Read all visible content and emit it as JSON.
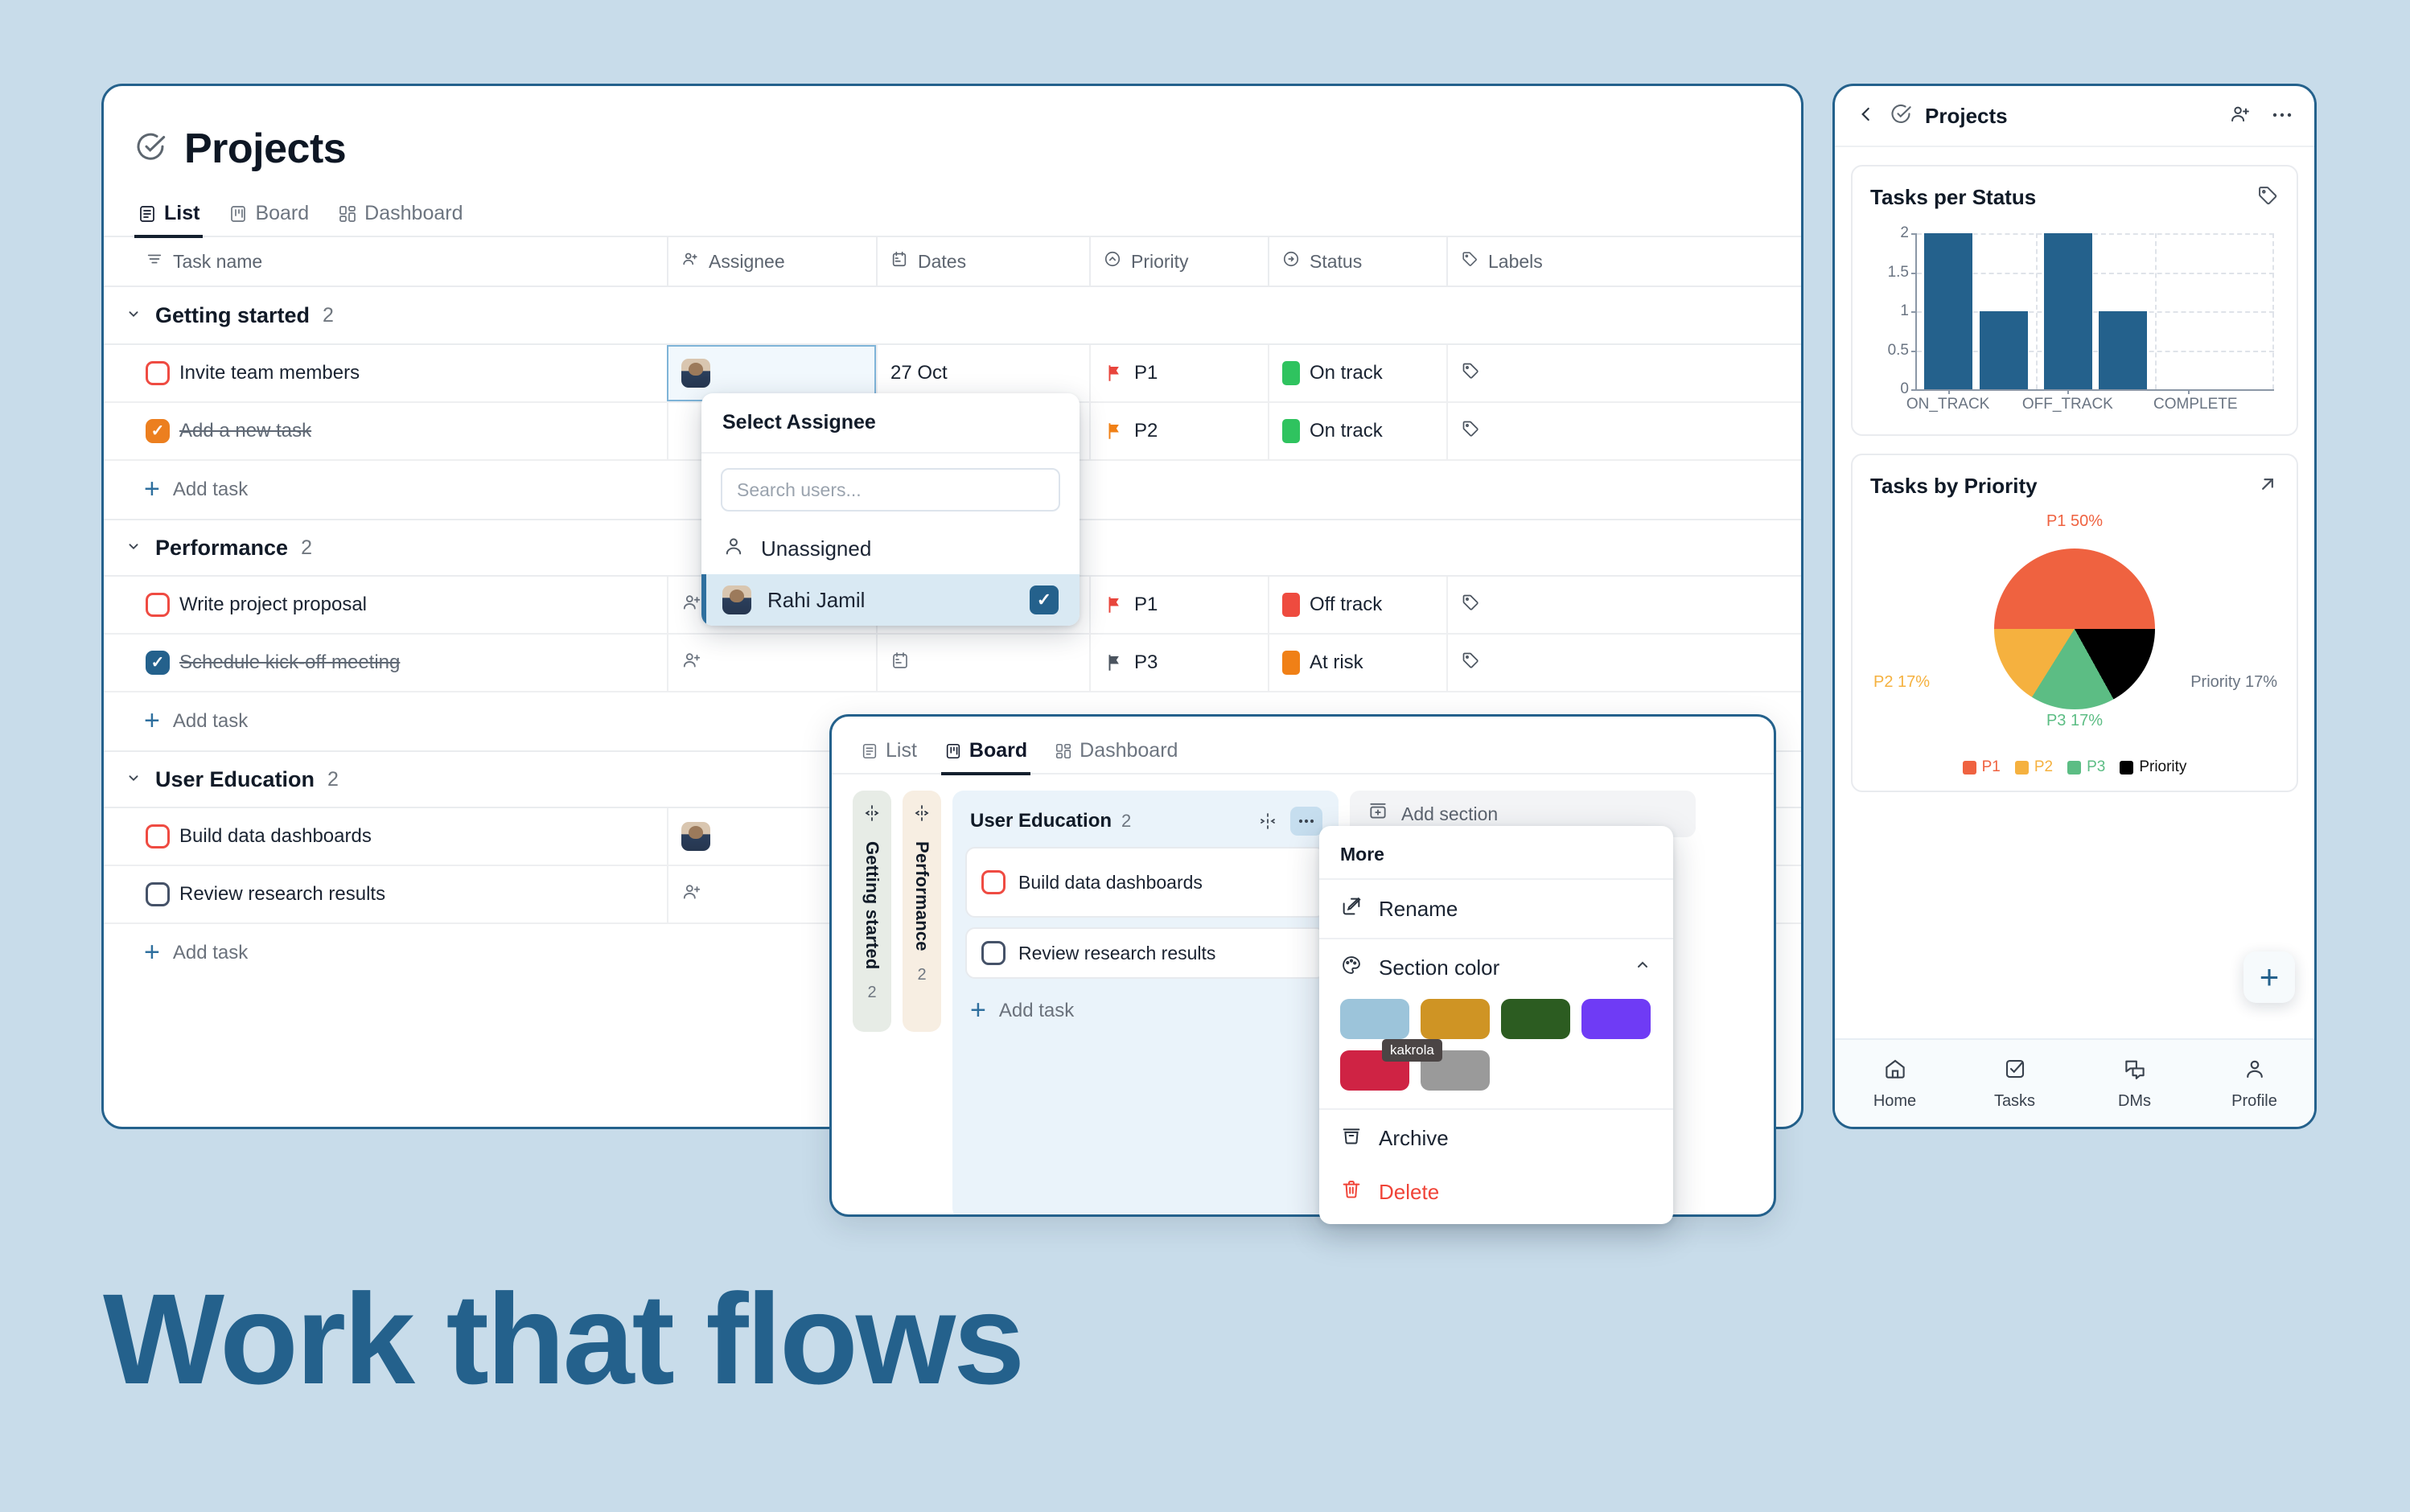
{
  "background_color": "#c8dcea",
  "accent_color": "#24618c",
  "hero": {
    "text": "Work that flows"
  },
  "list_panel": {
    "title": "Projects",
    "tabs": [
      {
        "label": "List",
        "icon": "list-icon",
        "active": true
      },
      {
        "label": "Board",
        "icon": "board-icon",
        "active": false
      },
      {
        "label": "Dashboard",
        "icon": "dashboard-icon",
        "active": false
      }
    ],
    "columns": [
      {
        "label": "Task name",
        "icon": "sort-lines-icon"
      },
      {
        "label": "Assignee",
        "icon": "person-plus-icon"
      },
      {
        "label": "Dates",
        "icon": "calendar-icon"
      },
      {
        "label": "Priority",
        "icon": "chevron-circle-icon"
      },
      {
        "label": "Status",
        "icon": "arrow-circle-icon"
      },
      {
        "label": "Labels",
        "icon": "tag-icon"
      }
    ],
    "add_task_label": "Add task",
    "sections": [
      {
        "name": "Getting started",
        "count": "2",
        "rows": [
          {
            "task": "Invite team members",
            "done": false,
            "assignee": "avatar",
            "date": "27 Oct",
            "priority": "P1",
            "priority_color": "#e8453c",
            "status": "On track",
            "status_color": "#2fc35f"
          },
          {
            "task": "Add a new task",
            "done": true,
            "check_color": "orange",
            "assignee": "",
            "date": "",
            "priority": "P2",
            "priority_color": "#f08016",
            "status": "On track",
            "status_color": "#2fc35f"
          }
        ]
      },
      {
        "name": "Performance",
        "count": "2",
        "rows": [
          {
            "task": "Write project proposal",
            "done": false,
            "assignee": "",
            "date": "",
            "priority": "P1",
            "priority_color": "#e8453c",
            "status": "Off track",
            "status_color": "#ee4b3f"
          },
          {
            "task": "Schedule kick-off meeting",
            "done": true,
            "check_color": "blue",
            "assignee": "",
            "date": "calendar",
            "priority": "P3",
            "priority_color": "#4b545f",
            "status": "At risk",
            "status_color": "#f08016"
          }
        ]
      },
      {
        "name": "User Education",
        "count": "2",
        "rows": [
          {
            "task": "Build data dashboards",
            "done": false,
            "assignee": "avatar",
            "date": "",
            "priority": "",
            "status": "",
            "status_color": ""
          },
          {
            "task": "Review research results",
            "done": false,
            "check_gray": true,
            "assignee": "",
            "date": "",
            "priority": "",
            "status": "",
            "status_color": ""
          }
        ]
      }
    ]
  },
  "assignee_popover": {
    "title": "Select Assignee",
    "search_placeholder": "Search users...",
    "options": [
      {
        "label": "Unassigned",
        "icon": "person-icon",
        "selected": false
      },
      {
        "label": "Rahi Jamil",
        "icon": "avatar",
        "selected": true
      }
    ]
  },
  "board_panel": {
    "tabs": [
      {
        "label": "List",
        "icon": "list-icon",
        "active": false
      },
      {
        "label": "Board",
        "icon": "board-icon",
        "active": true
      },
      {
        "label": "Dashboard",
        "icon": "dashboard-icon",
        "active": false
      }
    ],
    "collapsed_columns": [
      {
        "name": "Getting started",
        "count": "2",
        "color": "#e7ece6"
      },
      {
        "name": "Performance",
        "count": "2",
        "color": "#f7eee2"
      }
    ],
    "open_column": {
      "name": "User Education",
      "count": "2",
      "cards": [
        {
          "task": "Build data dashboards",
          "checkbox": "red"
        },
        {
          "task": "Review research results",
          "checkbox": "gray"
        }
      ],
      "add_task_label": "Add task"
    },
    "add_section_label": "Add section"
  },
  "more_menu": {
    "title": "More",
    "items": [
      {
        "label": "Rename",
        "icon": "pencil-square-icon"
      },
      {
        "label": "Section color",
        "icon": "palette-icon",
        "expanded": true
      },
      {
        "label": "Archive",
        "icon": "archive-icon"
      },
      {
        "label": "Delete",
        "icon": "trash-icon",
        "danger": true
      }
    ],
    "swatches": [
      "#9cc4da",
      "#cf9424",
      "#2c5c21",
      "#6f3bf5",
      "#cf2344",
      "#9a9a9a"
    ],
    "tooltip": "kakrola"
  },
  "mobile_panel": {
    "title": "Projects",
    "back_icon": "chevron-left-icon",
    "check_icon": "check-circle-icon",
    "actions": [
      {
        "icon": "person-plus-icon"
      },
      {
        "icon": "more-dots-icon"
      }
    ],
    "fab_label": "+",
    "nav": [
      {
        "label": "Home",
        "icon": "home-icon"
      },
      {
        "label": "Tasks",
        "icon": "check-square-icon"
      },
      {
        "label": "DMs",
        "icon": "chat-icon"
      },
      {
        "label": "Profile",
        "icon": "person-icon"
      }
    ]
  },
  "chart_data": [
    {
      "type": "bar",
      "title": "Tasks per Status",
      "categories": [
        "ON_TRACK",
        "",
        "OFF_TRACK",
        "",
        "COMPLETE"
      ],
      "tick_labels": [
        "ON_TRACK",
        "OFF_TRACK",
        "COMPLETE"
      ],
      "values": [
        2,
        1,
        2,
        1,
        0
      ],
      "bar_color": "#24618c",
      "ylim": [
        0,
        2
      ],
      "yticks": [
        "0",
        "0.5",
        "1",
        "1.5",
        "2"
      ],
      "xlabel": "",
      "ylabel": "",
      "grid": true,
      "legend": "none"
    },
    {
      "type": "pie",
      "title": "Tasks by Priority",
      "labels": [
        "P1",
        "P2",
        "P3",
        "Priority"
      ],
      "values": [
        50,
        17,
        17,
        17
      ],
      "value_labels": [
        "P1 50%",
        "P2 17%",
        "P3 17%",
        "Priority 17%"
      ],
      "colors": [
        "#ef6240",
        "#f5b13f",
        "#5cbd84",
        "#000000"
      ],
      "legend": "bottom",
      "legend_entries": [
        "P1",
        "P2",
        "P3",
        "Priority"
      ]
    }
  ]
}
